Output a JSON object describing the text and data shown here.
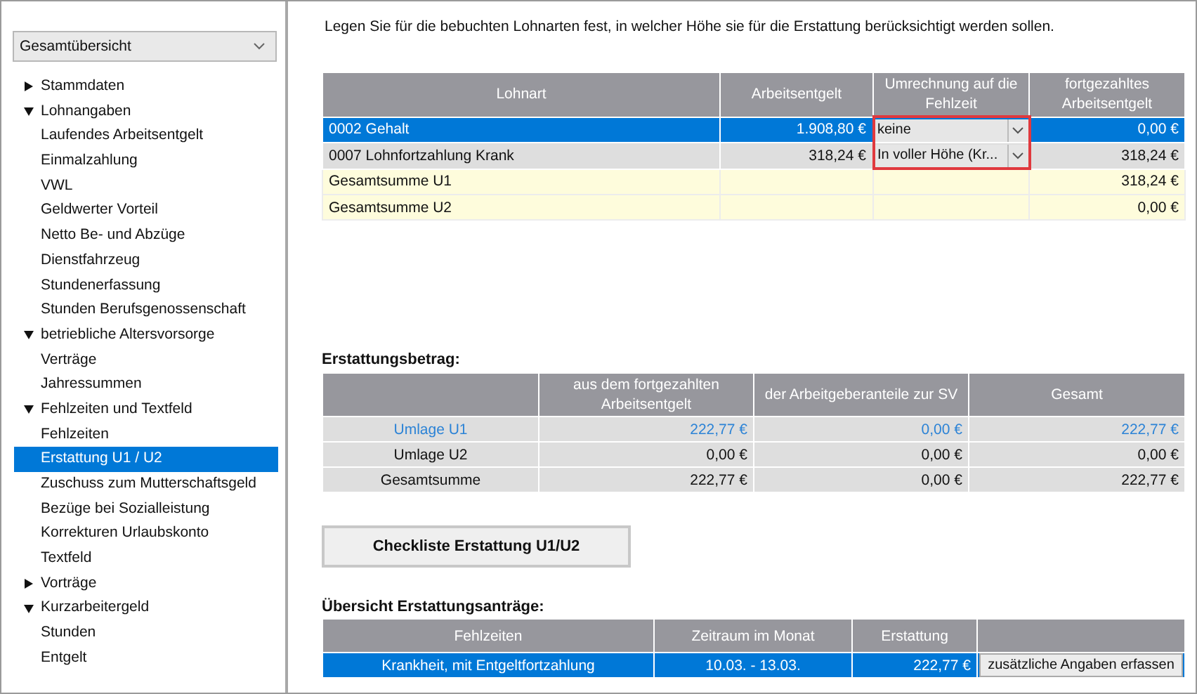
{
  "sidebar": {
    "view_select": {
      "value": "Gesamtübersicht"
    },
    "tree": [
      {
        "label": "Stammdaten",
        "expanded": false,
        "selected": false
      },
      {
        "label": "Lohnangaben",
        "expanded": true,
        "selected": false,
        "children": [
          {
            "label": "Laufendes Arbeitsentgelt",
            "selected": false
          },
          {
            "label": "Einmalzahlung",
            "selected": false
          },
          {
            "label": "VWL",
            "selected": false
          },
          {
            "label": "Geldwerter Vorteil",
            "selected": false
          },
          {
            "label": "Netto Be- und Abzüge",
            "selected": false
          },
          {
            "label": "Dienstfahrzeug",
            "selected": false
          },
          {
            "label": "Stundenerfassung",
            "selected": false
          },
          {
            "label": "Stunden Berufsgenossenschaft",
            "selected": false
          }
        ]
      },
      {
        "label": "betriebliche Altersvorsorge",
        "expanded": true,
        "selected": false,
        "children": [
          {
            "label": "Verträge",
            "selected": false
          },
          {
            "label": "Jahressummen",
            "selected": false
          }
        ]
      },
      {
        "label": "Fehlzeiten und Textfeld",
        "expanded": true,
        "selected": false,
        "children": [
          {
            "label": "Fehlzeiten",
            "selected": false
          },
          {
            "label": "Erstattung U1 / U2",
            "selected": true
          },
          {
            "label": "Zuschuss zum Mutterschaftsgeld",
            "selected": false
          },
          {
            "label": "Bezüge bei Sozialleistung",
            "selected": false
          },
          {
            "label": "Korrekturen Urlaubskonto",
            "selected": false
          },
          {
            "label": "Textfeld",
            "selected": false
          }
        ]
      },
      {
        "label": "Vorträge",
        "expanded": false,
        "selected": false
      },
      {
        "label": "Kurzarbeitergeld",
        "expanded": true,
        "selected": false,
        "children": [
          {
            "label": "Stunden",
            "selected": false
          },
          {
            "label": "Entgelt",
            "selected": false
          }
        ]
      }
    ]
  },
  "intro": "Legen Sie für die bebuchten Lohnarten fest, in welcher Höhe sie für die Erstattung berücksichtigt werden sollen.",
  "wage_table": {
    "columns": [
      "Lohnart",
      "Arbeitsentgelt",
      "Umrechnung auf die Fehlzeit",
      "fortgezahltes Arbeitsentgelt"
    ],
    "rows": [
      {
        "kind": "item",
        "selected": true,
        "cells": [
          "0002 Gehalt",
          "1.908,80 €",
          "keine",
          "0,00 €"
        ]
      },
      {
        "kind": "item",
        "selected": false,
        "cells": [
          "0007 Lohnfortzahlung Krank",
          "318,24 €",
          "In voller Höhe (Kr...",
          "318,24 €"
        ]
      },
      {
        "kind": "total",
        "selected": false,
        "cells": [
          "Gesamtsumme U1",
          "",
          "",
          "318,24 €"
        ]
      },
      {
        "kind": "total",
        "selected": false,
        "cells": [
          "Gesamtsumme U2",
          "",
          "",
          "0,00 €"
        ]
      }
    ]
  },
  "refund": {
    "heading": "Erstattungsbetrag:",
    "columns": [
      "aus dem fortgezahlten Arbeitsentgelt",
      "der Arbeitgeberanteile zur SV",
      "Gesamt"
    ],
    "rows": [
      {
        "kind": "link",
        "label": "Umlage U1",
        "values": [
          "222,77 €",
          "0,00 €",
          "222,77 €"
        ]
      },
      {
        "kind": "plain",
        "label": "Umlage U2",
        "values": [
          "0,00 €",
          "0,00 €",
          "0,00 €"
        ]
      },
      {
        "kind": "plain",
        "label": "Gesamtsumme",
        "values": [
          "222,77 €",
          "0,00 €",
          "222,77 €"
        ]
      }
    ]
  },
  "checklist_button": "Checkliste Erstattung U1/U2",
  "claims": {
    "heading": "Übersicht Erstattungsanträge:",
    "columns": [
      "Fehlzeiten",
      "Zeitraum im Monat",
      "Erstattung"
    ],
    "rows": [
      {
        "selected": true,
        "absence": "Krankheit, mit Entgeltfortzahlung",
        "period": "10.03. - 13.03.",
        "amount": "222,77 €",
        "action": "zusätzliche Angaben erfassen"
      }
    ]
  }
}
